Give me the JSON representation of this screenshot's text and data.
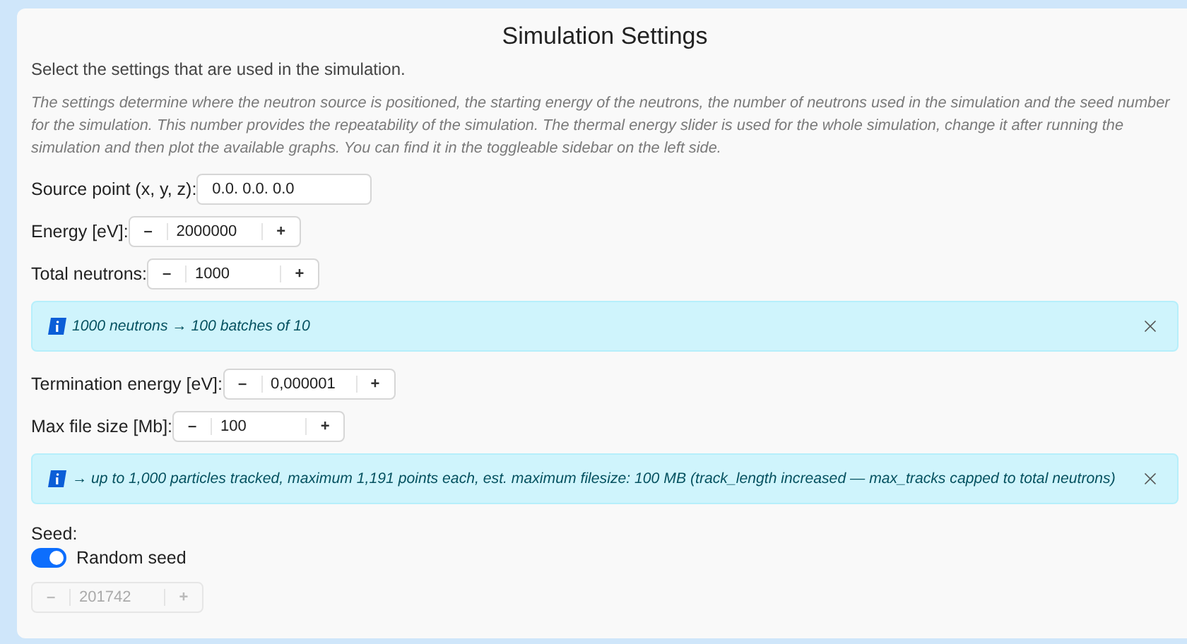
{
  "title": "Simulation Settings",
  "intro": "Select the settings that are used in the simulation.",
  "description": "The settings determine where the neutron source is positioned, the starting energy of the neutrons, the number of neutrons used in the simulation and the seed number for the simulation. This number provides the repeatability of the simulation. The thermal energy slider is used for the whole simulation, change it after running the simulation and then plot the available graphs. You can find it in the toggleable sidebar on the left side.",
  "items": [
    {
      "kind": "text",
      "label": "Source point (x, y, z):",
      "value": "0.0. 0.0. 0.0"
    },
    {
      "kind": "number",
      "label": "Energy [eV]:",
      "value": "2000000",
      "minus": "–",
      "plus": "+"
    },
    {
      "kind": "number",
      "label": "Total neutrons:",
      "value": "1000",
      "minus": "–",
      "plus": "+"
    },
    {
      "kind": "alert",
      "text": "1000 neutrons → 100 batches of 10"
    },
    {
      "kind": "number",
      "label": "Termination energy [eV]:",
      "value": "0,000001",
      "minus": "–",
      "plus": "+"
    },
    {
      "kind": "number",
      "label": "Max file size [Mb]:",
      "value": "100",
      "minus": "–",
      "plus": "+"
    },
    {
      "kind": "alert",
      "text": "→ up to 1,000 particles tracked, maximum 1,191 points each, est. maximum filesize: 100 MB (track_length increased — max_tracks capped to total neutrons)"
    }
  ],
  "seed": {
    "label": "Seed:",
    "toggle": {
      "label": "Random seed",
      "on": true
    },
    "input": {
      "value": "201742",
      "minus": "–",
      "plus": "+",
      "disabled": true
    }
  }
}
